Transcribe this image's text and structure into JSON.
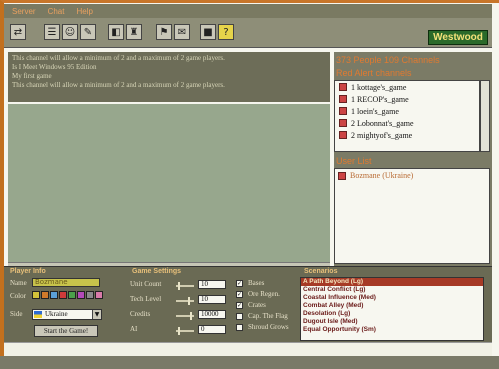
{
  "menu": [
    "Server",
    "Chat",
    "Help"
  ],
  "toolbar": {
    "icons": [
      "server-icon",
      "channel-icon",
      "user-icon",
      "options-icon",
      "game-icon",
      "ladder-icon",
      "find-icon",
      "page-icon",
      "stop-icon",
      "help-icon"
    ],
    "help_glyph": "?"
  },
  "brand": {
    "logo": "Westwood"
  },
  "chat": {
    "lines": [
      "This channel will allow a minimum of 2 and a maximum of 2 game players.",
      "Is I Meet Windows 95 Edition",
      "My first game",
      "This channel will allow a minimum of 2 and a maximum of 2 game players."
    ]
  },
  "right_panel": {
    "people_count": "373 People 109 Channels",
    "channels_header": "Red Alert channels",
    "channels": [
      "1 kottage's_game",
      "1 RECOP's_game",
      "1 loein's_game",
      "2 Lobonnat's_game",
      "2 mightyof's_game"
    ],
    "users_header": "User List",
    "users": [
      "Bozmane (Ukraine)"
    ]
  },
  "player_info": {
    "section_title": "Player Info",
    "name_label": "Name",
    "name_value": "Bozmane",
    "color_label": "Color",
    "colors": [
      "#d2c23a",
      "#d07a2a",
      "#5aa0d8",
      "#cf3a3a",
      "#4aa04a",
      "#b24ab8",
      "#8a8a8a",
      "#d87aa8"
    ],
    "side_label": "Side",
    "side_value": "Ukraine",
    "start_button": "Start the Game!"
  },
  "game_settings": {
    "section_title": "Game Settings",
    "unit_count_label": "Unit Count",
    "unit_count_value": "10",
    "tech_level_label": "Tech Level",
    "tech_level_value": "10",
    "credits_label": "Credits",
    "credits_value": "10000",
    "ai_label": "AI",
    "ai_value": "0",
    "checkboxes": [
      {
        "label": "Bases",
        "checked": true
      },
      {
        "label": "Ore Regen.",
        "checked": true
      },
      {
        "label": "Crates",
        "checked": true
      },
      {
        "label": "Cap. The Flag",
        "checked": false
      },
      {
        "label": "Shroud Grows",
        "checked": false
      }
    ]
  },
  "scenarios": {
    "section_title": "Scenarios",
    "items": [
      "A Path Beyond (Lg)",
      "Central Conflict (Lg)",
      "Coastal Influence (Med)",
      "Combat Alley (Med)",
      "Desolation (Lg)",
      "Dugout Isle (Med)",
      "Equal Opportunity (Sm)"
    ],
    "selected_index": 0
  }
}
